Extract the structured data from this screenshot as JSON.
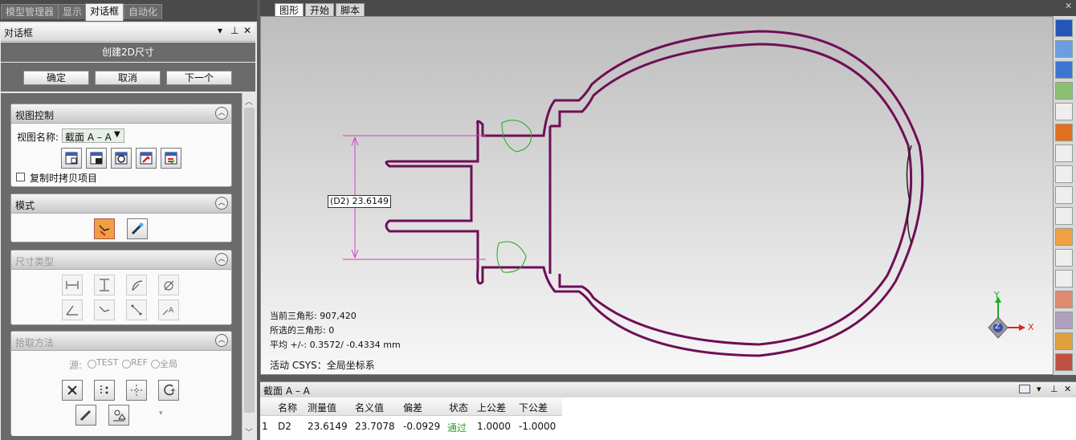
{
  "top_tabs": [
    "模型管理器",
    "显示",
    "对话框",
    "自动化"
  ],
  "dialog": {
    "bar_title": "对话框",
    "title": "创建2D尺寸",
    "buttons": [
      "确定",
      "取消",
      "下一个"
    ]
  },
  "view_control": {
    "title": "视图控制",
    "view_name_label": "视图名称:",
    "view_name_value": "截面 A – A",
    "copy_label": "复制时拷贝项目"
  },
  "mode": {
    "title": "模式"
  },
  "dim_type": {
    "title": "尺寸类型"
  },
  "pick": {
    "title": "拾取方法",
    "source_label": "源:",
    "options": [
      "TEST",
      "REF",
      "全局"
    ]
  },
  "viewport_tabs": [
    "图形",
    "开始",
    "脚本"
  ],
  "viewport": {
    "dim_label": "(D2) 23.6149",
    "info1": "当前三角形: 907,420",
    "info2": "所选的三角形: 0",
    "info3": "平均 +/-: 0.3572/ -0.4334 mm",
    "csys": "活动 CSYS：全局坐标系",
    "axis_y": "Y",
    "axis_x": "X",
    "axis_z": "Z"
  },
  "table": {
    "title": "截面 A – A",
    "headers": [
      "名称",
      "测量值",
      "名义值",
      "偏差",
      "状态",
      "上公差",
      "下公差"
    ],
    "rows": [
      [
        "1",
        "D2",
        "23.6149",
        "23.7078",
        "-0.0929",
        "通过",
        "1.0000",
        "-1.0000"
      ]
    ]
  },
  "colors": {
    "pass": "#2ca02c",
    "dimension": "#d040d0",
    "part": "#6e0f55"
  }
}
